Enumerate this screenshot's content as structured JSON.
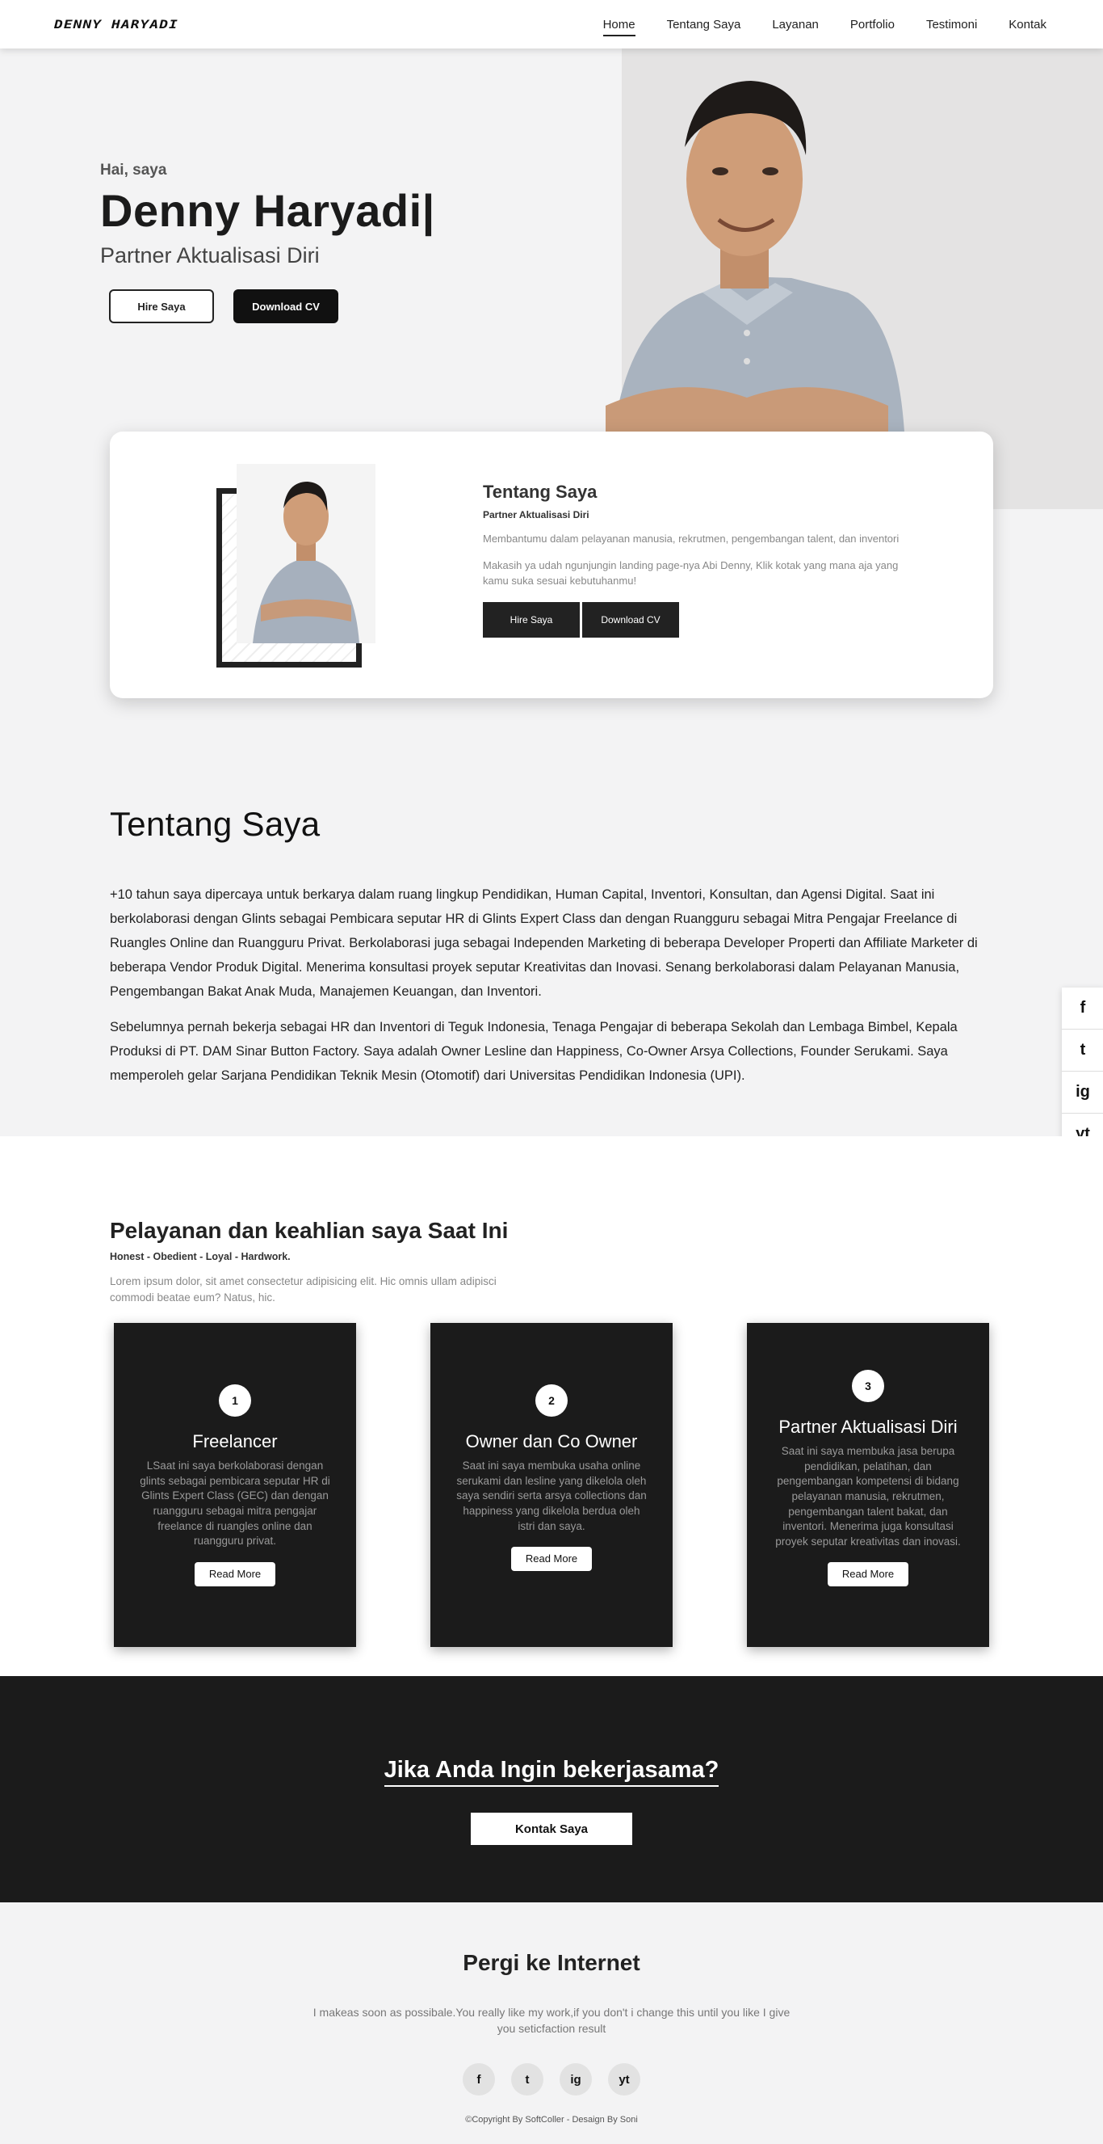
{
  "nav": {
    "logo": "DENNY HARYADI",
    "items": [
      "Home",
      "Tentang Saya",
      "Layanan",
      "Portfolio",
      "Testimoni",
      "Kontak"
    ]
  },
  "hero": {
    "greeting": "Hai, saya",
    "name": "Denny Haryadi|",
    "tagline": "Partner Aktualisasi Diri",
    "hire_label": "Hire Saya",
    "cv_label": "Download CV"
  },
  "about_card": {
    "title": "Tentang Saya",
    "subtitle": "Partner Aktualisasi Diri",
    "p1": "Membantumu dalam pelayanan manusia, rekrutmen, pengembangan talent, dan inventori",
    "p2": "Makasih ya udah ngunjungin landing page-nya Abi Denny, Klik kotak yang mana aja yang kamu suka sesuai kebutuhanmu!",
    "hire_label": "Hire Saya",
    "cv_label": "Download CV"
  },
  "tentang": {
    "title": "Tentang Saya",
    "p1": "+10 tahun saya dipercaya untuk berkarya dalam ruang lingkup Pendidikan, Human Capital, Inventori, Konsultan, dan Agensi Digital. Saat ini berkolaborasi dengan Glints sebagai Pembicara seputar HR di Glints Expert Class dan dengan Ruangguru sebagai Mitra Pengajar Freelance di Ruangles Online dan Ruangguru Privat. Berkolaborasi juga sebagai Independen Marketing di beberapa Developer Properti dan Affiliate Marketer di beberapa Vendor Produk Digital. Menerima konsultasi proyek seputar Kreativitas dan Inovasi. Senang berkolaborasi dalam Pelayanan Manusia, Pengembangan Bakat Anak Muda, Manajemen Keuangan, dan Inventori.",
    "p2": "Sebelumnya pernah bekerja sebagai HR dan Inventori di Teguk Indonesia, Tenaga Pengajar di beberapa Sekolah dan Lembaga Bimbel, Kepala Produksi di PT. DAM Sinar Button Factory. Saya adalah Owner Lesline dan Happiness, Co-Owner Arsya Collections, Founder Serukami. Saya memperoleh gelar Sarjana Pendidikan Teknik Mesin (Otomotif) dari Universitas Pendidikan Indonesia (UPI)."
  },
  "social_side": [
    "f",
    "t",
    "ig",
    "yt"
  ],
  "services": {
    "title": "Pelayanan dan keahlian saya Saat Ini",
    "subtitle": "Honest - Obedient - Loyal - Hardwork.",
    "desc": "Lorem ipsum dolor, sit amet consectetur adipisicing elit. Hic omnis ullam adipisci commodi beatae eum? Natus, hic.",
    "cards": [
      {
        "num": "1",
        "name": "Freelancer",
        "text": "LSaat ini saya berkolaborasi dengan glints sebagai pembicara seputar HR di Glints Expert Class (GEC) dan dengan ruangguru sebagai mitra pengajar freelance di ruangles online dan ruangguru privat.",
        "btn": "Read More"
      },
      {
        "num": "2",
        "name": "Owner dan Co Owner",
        "text": "Saat ini saya membuka usaha online serukami dan lesline yang dikelola oleh saya sendiri serta arsya collections dan happiness yang dikelola berdua oleh istri dan saya.",
        "btn": "Read More"
      },
      {
        "num": "3",
        "name": "Partner Aktualisasi Diri",
        "text": "Saat ini saya membuka jasa berupa pendidikan, pelatihan, dan pengembangan kompetensi di bidang pelayanan manusia, rekrutmen, pengembangan talent bakat, dan inventori. Menerima juga konsultasi proyek seputar kreativitas dan inovasi.",
        "btn": "Read More"
      }
    ]
  },
  "cta": {
    "title": "Jika Anda Ingin bekerjasama?",
    "button": "Kontak Saya"
  },
  "footer": {
    "title": "Pergi ke Internet",
    "text": "I makeas soon as possibale.You really like my work,if you don't i change this until you like I give you seticfaction result",
    "icons": [
      "f",
      "t",
      "ig",
      "yt"
    ],
    "copyright": "©Copyright By SoftColler - Desaign By Soni"
  }
}
